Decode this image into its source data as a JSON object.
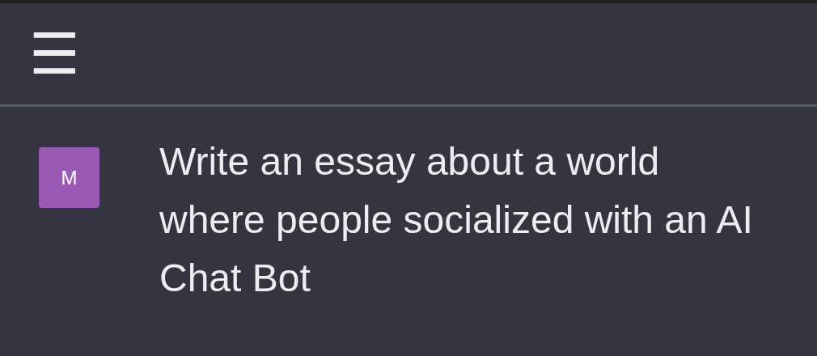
{
  "header": {
    "menu": "☰"
  },
  "messages": [
    {
      "kind": "user",
      "avatar": "M",
      "color": "#9b59b6",
      "text": "Write an essay about a world where people socialized with an AI Chat Bot"
    }
  ]
}
